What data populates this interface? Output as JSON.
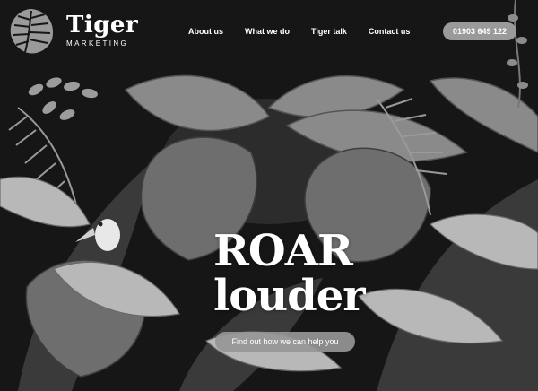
{
  "brand": {
    "name": "Tiger",
    "subtitle": "MARKETING",
    "logo_icon": "monstera-leaf-logo-icon"
  },
  "nav": {
    "items": [
      {
        "label": "About us"
      },
      {
        "label": "What we do"
      },
      {
        "label": "Tiger talk"
      },
      {
        "label": "Contact us"
      }
    ],
    "phone": "01903 649 122"
  },
  "hero": {
    "line1": "ROAR",
    "line2": "louder",
    "cta_label": "Find out how we can help you",
    "background_icon": "jungle-leaves-illustration"
  },
  "colors": {
    "background": "#161616",
    "text": "#ffffff",
    "pill": "#9a9a9a"
  }
}
